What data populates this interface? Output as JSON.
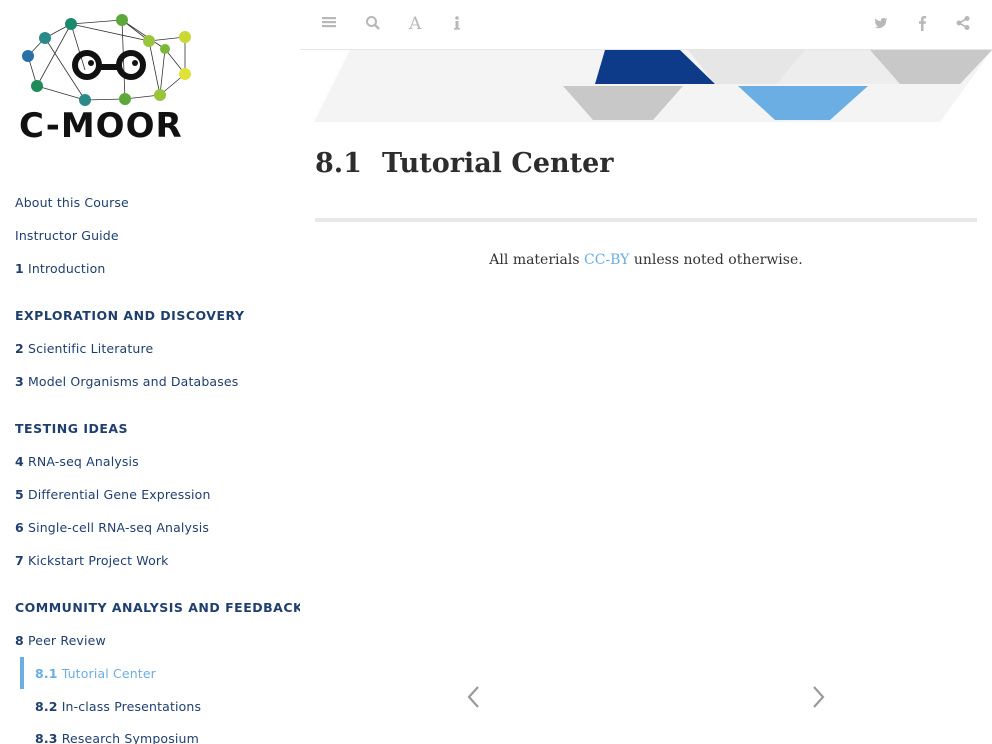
{
  "logo": {
    "text": "C-MOOR"
  },
  "sidebar": {
    "items": [
      {
        "num": "",
        "label": "About this Course"
      },
      {
        "num": "",
        "label": "Instructor Guide"
      },
      {
        "num": "1",
        "label": "Introduction"
      }
    ],
    "sections": [
      {
        "heading": "EXPLORATION AND DISCOVERY",
        "items": [
          {
            "num": "2",
            "label": "Scientific Literature"
          },
          {
            "num": "3",
            "label": "Model Organisms and Databases"
          }
        ]
      },
      {
        "heading": "TESTING IDEAS",
        "items": [
          {
            "num": "4",
            "label": "RNA-seq Analysis"
          },
          {
            "num": "5",
            "label": "Differential Gene Expression"
          },
          {
            "num": "6",
            "label": "Single-cell RNA-seq Analysis"
          },
          {
            "num": "7",
            "label": "Kickstart Project Work"
          }
        ]
      },
      {
        "heading": "COMMUNITY ANALYSIS AND FEEDBACK",
        "items": [
          {
            "num": "8",
            "label": "Peer Review"
          },
          {
            "num": "8.1",
            "label": "Tutorial Center",
            "active": true
          },
          {
            "num": "8.2",
            "label": "In-class Presentations"
          },
          {
            "num": "8.3",
            "label": "Research Symposium"
          }
        ]
      }
    ]
  },
  "toolbar": {
    "left": [
      "toc-toggle-icon",
      "search-icon",
      "font-settings-icon",
      "info-icon"
    ],
    "right": [
      "twitter-icon",
      "facebook-icon",
      "share-icon"
    ]
  },
  "page": {
    "section_number": "8.1",
    "title": "Tutorial Center",
    "note_prefix": "All materials ",
    "note_link": "CC-BY",
    "note_suffix": " unless noted otherwise."
  },
  "colors": {
    "nav_text": "#1f3f6e",
    "accent": "#6aaee3",
    "banner_dark": "#0d3b8a",
    "banner_light": "#6aaee3"
  }
}
